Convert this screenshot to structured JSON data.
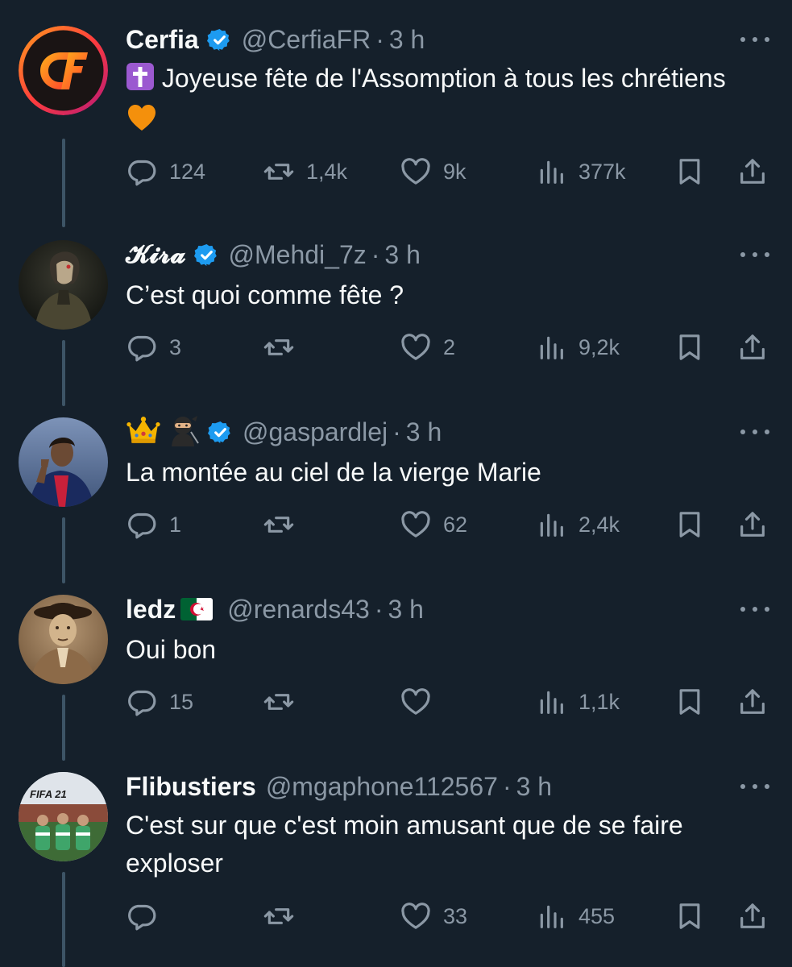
{
  "tweets": [
    {
      "display_name": "Cerfia",
      "verified": true,
      "handle": "@CerfiaFR",
      "dot": "·",
      "time": "3 h",
      "text": "Joyeuse fête de l'Assomption à tous les chrétiens",
      "text_prefix_emoji": "latin-cross-emoji",
      "text_suffix_emoji": "orange-heart-emoji",
      "replies": "124",
      "retweets": "1,4k",
      "likes": "9k",
      "views": "377k"
    },
    {
      "display_name": "𝓚𝓲𝓻𝓪",
      "verified": true,
      "handle": "@Mehdi_7z",
      "dot": "·",
      "time": "3 h",
      "text": "C’est quoi comme fête ?",
      "replies": "3",
      "retweets": "",
      "likes": "2",
      "views": "9,2k"
    },
    {
      "display_name_emojis": [
        "crown-emoji",
        "ninja-emoji"
      ],
      "verified": true,
      "handle": "@gaspardlej",
      "dot": "·",
      "time": "3 h",
      "text": "La montée au ciel de la vierge Marie",
      "replies": "1",
      "retweets": "",
      "likes": "62",
      "views": "2,4k"
    },
    {
      "display_name": "ledz",
      "display_name_flag": "algeria-flag-emoji",
      "verified": false,
      "handle": "@renards43",
      "dot": "·",
      "time": "3 h",
      "text": "Oui bon",
      "replies": "15",
      "retweets": "",
      "likes": "",
      "views": "1,1k"
    },
    {
      "display_name": "Flibustiers",
      "verified": false,
      "handle": "@mgaphone112567",
      "dot": "·",
      "time": "3 h",
      "text": "C'est sur que c'est moin amusant que de se faire exploser",
      "avatar_overlay_text": "FIFA 21",
      "replies": "",
      "retweets": "",
      "likes": "33",
      "views": "455"
    }
  ],
  "colors": {
    "background": "#15202b",
    "text": "#f7f9f9",
    "muted": "#8b98a5",
    "verified": "#1d9bf0",
    "thread_line": "#3d5466"
  }
}
